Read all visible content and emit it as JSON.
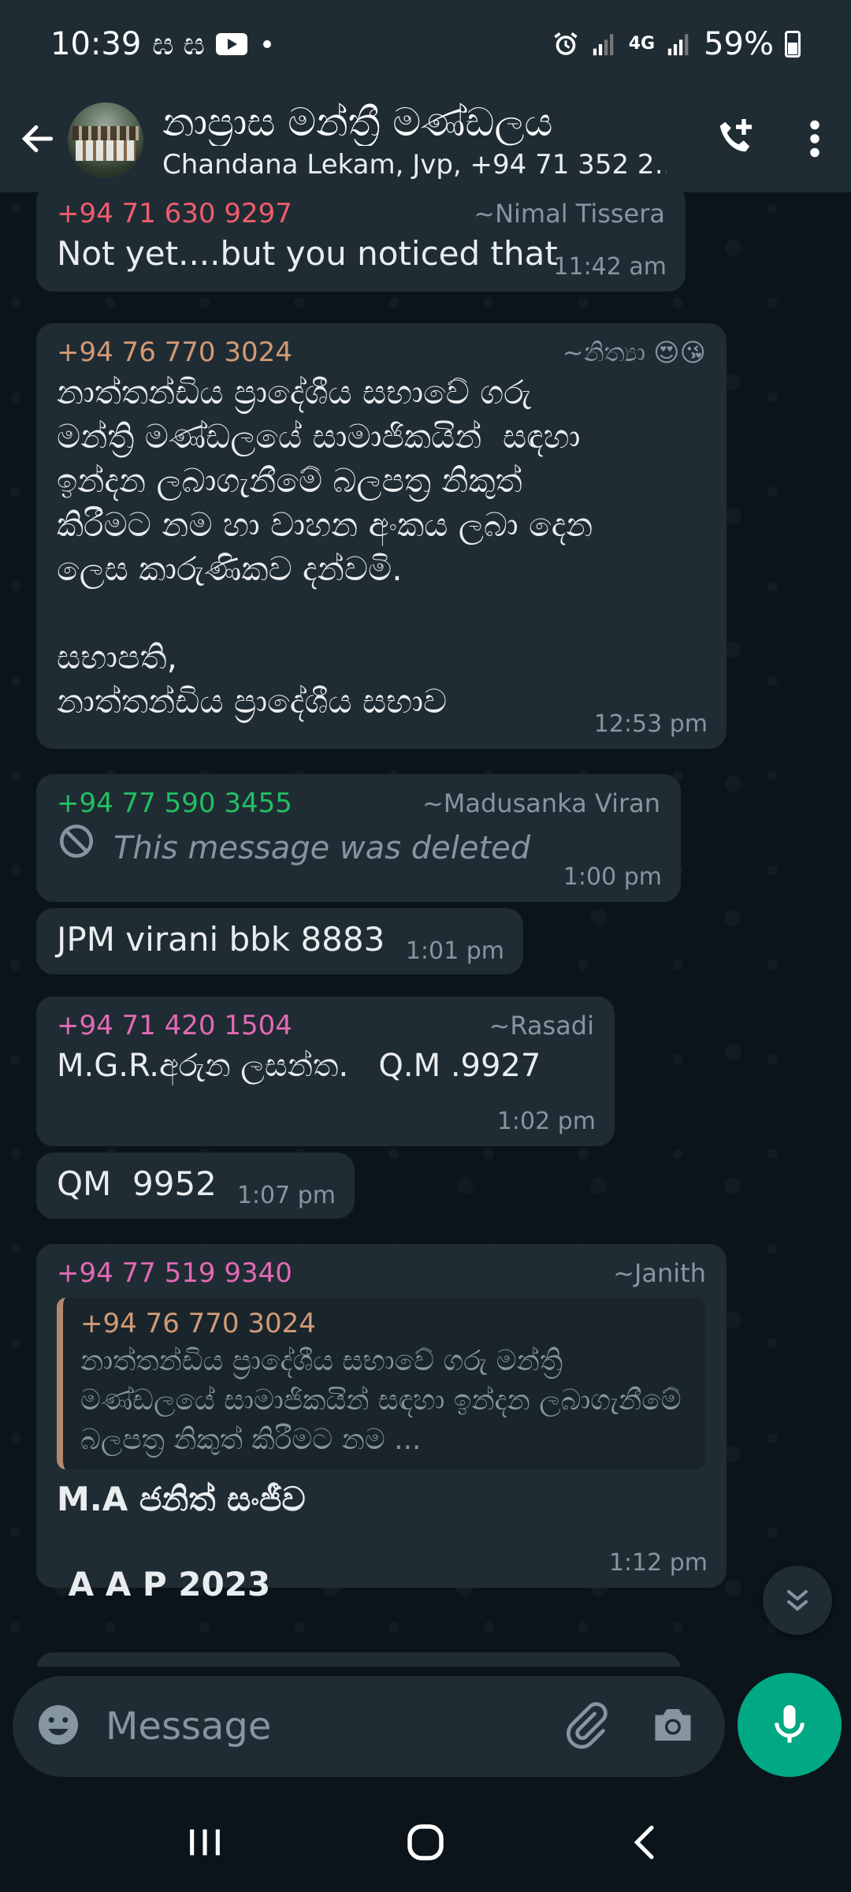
{
  "status_bar": {
    "time": "10:39",
    "notif_glyphs": "ඝ ඝ",
    "signal_label": "4G",
    "battery": "59%"
  },
  "header": {
    "title": "නාප්‍රාස මන්ත්‍රී මණ්ඩලය",
    "subtitle": "Chandana Lekam, Jvp, +94 71 352 2…"
  },
  "messages": [
    {
      "number": "+94 71 630 9297",
      "number_color": "#f15c6d",
      "alias": "~Nimal Tissera",
      "text": "Not yet....but you noticed that",
      "time": "11:42 am"
    },
    {
      "number": "+94 76 770 3024",
      "number_color": "#d29a76",
      "alias": "~නිත්‍යා 😍😘",
      "text": "නාත්තන්ඩිය ප්‍රාදේශීය සභාවේ ගරු\nමන්ත්‍රි මණ්ඩලයේ සාමාජිකයින්  සඳහා\nඉන්දන ලබාගැනීමේ බලපත්‍ර නිකුත්\nකිරීමට නම හා වාහන අංකය ලබා දෙන\nලෙස කාරුණිකව දන්වමි.\n\nසභාපති,\nනාත්තන්ඩිය ප්‍රාදේශීය සභාව",
      "time": "12:53 pm"
    },
    {
      "number": "+94 77 590 3455",
      "number_color": "#21c063",
      "alias": "~Madusanka Viran",
      "text": "This message was deleted",
      "time": "1:00 pm"
    },
    {
      "text": "JPM virani bbk 8883",
      "time": "1:01 pm"
    },
    {
      "number": "+94 71 420 1504",
      "number_color": "#e26ab6",
      "alias": "~Rasadi",
      "text": "M.G.R.අරුන ලසන්ත.   Q.M .9927",
      "time": "1:02 pm"
    },
    {
      "text": "QM  9952",
      "time": "1:07 pm"
    },
    {
      "number": "+94 77 519 9340",
      "number_color": "#e26ab6",
      "alias": "~Janith",
      "quote_number": "+94 76 770 3024",
      "quote_text": "නාත්තන්ඩිය ප්‍රාදේශීය සභාවේ ගරු  මන්ත්‍රි මණ්ඩලයේ සාමාජිකයින්  සඳහා ඉන්දන ලබාගැනීමේ බලපත්‍ර නිකුත් කිරීමට නම ...",
      "line1": "M.A ජනිත් සංජීව",
      "line2": " A A P 2023",
      "time": "1:12 pm"
    }
  ],
  "input": {
    "placeholder": "Message"
  },
  "colors": {
    "accent": "#00a884",
    "bubble": "#202c33",
    "header": "#1f2c34"
  }
}
